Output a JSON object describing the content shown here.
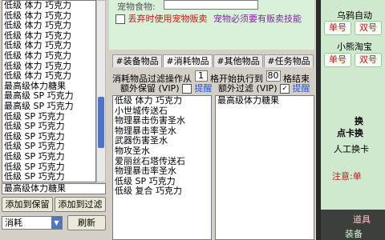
{
  "left_list": {
    "items": [
      "低级 体力 巧克力",
      "低级 体力 巧克力",
      "低级 体力 巧克力",
      "低级 体力 巧克力",
      "低级 体力 巧克力",
      "低级 体力 巧克力",
      "低级 体力 巧克力",
      "低级 体力 巧克力",
      "最高级体力糖果",
      "最高级 SP 巧克力",
      "最高级 SP 巧克力",
      "低级 SP 巧克力",
      "低级 SP 巧克力",
      "低级 SP 巧克力",
      "低级 SP 巧克力",
      "低级 SP 巧克力",
      "低级 SP 巧克力",
      "低级 SP 巧克力"
    ],
    "selected": "最高级体力糖果"
  },
  "left_buttons": {
    "add_keep": "添加到保留",
    "add_filter": "添加到过滤",
    "category": "消耗",
    "refresh": "刷新"
  },
  "top": {
    "pet_food_label": "宠物食物:",
    "discard_label": "丢弃时使用宠物贩卖",
    "skill_note": "宠物必须要有贩卖技能"
  },
  "tabs": [
    "#装备物品",
    "#消耗物品",
    "#其他物品",
    "#任务物品"
  ],
  "filter_row": {
    "label": "消耗物品过滤操作从",
    "from": "1",
    "mid": "格开始执行到",
    "to": "80",
    "end": "格结束"
  },
  "keep_header": {
    "label": "额外保留 (VIP)",
    "toggle": "提醒"
  },
  "filter_header": {
    "label": "额外过滤 (VIP)",
    "toggle": "提醒"
  },
  "keep_list": [
    "低级 体力 巧克力",
    "小世城传送石",
    "物理暴击伤害圣水",
    "物理暴击率圣水",
    "武器伤害圣水",
    "物攻圣水",
    "爱丽丝石塔传送石",
    "物理暴击率圣水",
    "低级 SP 巧克力",
    "低级 复合 巧克力"
  ],
  "filter_list": [
    "最高级体力糖果"
  ],
  "right": {
    "group1_title": "乌鸦自动",
    "single": "单号",
    "double": "双号",
    "group2_title": "小熊淘宝",
    "text1": "换",
    "text2": "点卡换",
    "group3_title": "人工换卡",
    "text3": "注意:单"
  },
  "bottom_right": {
    "road": "道具",
    "equip": "装备"
  }
}
